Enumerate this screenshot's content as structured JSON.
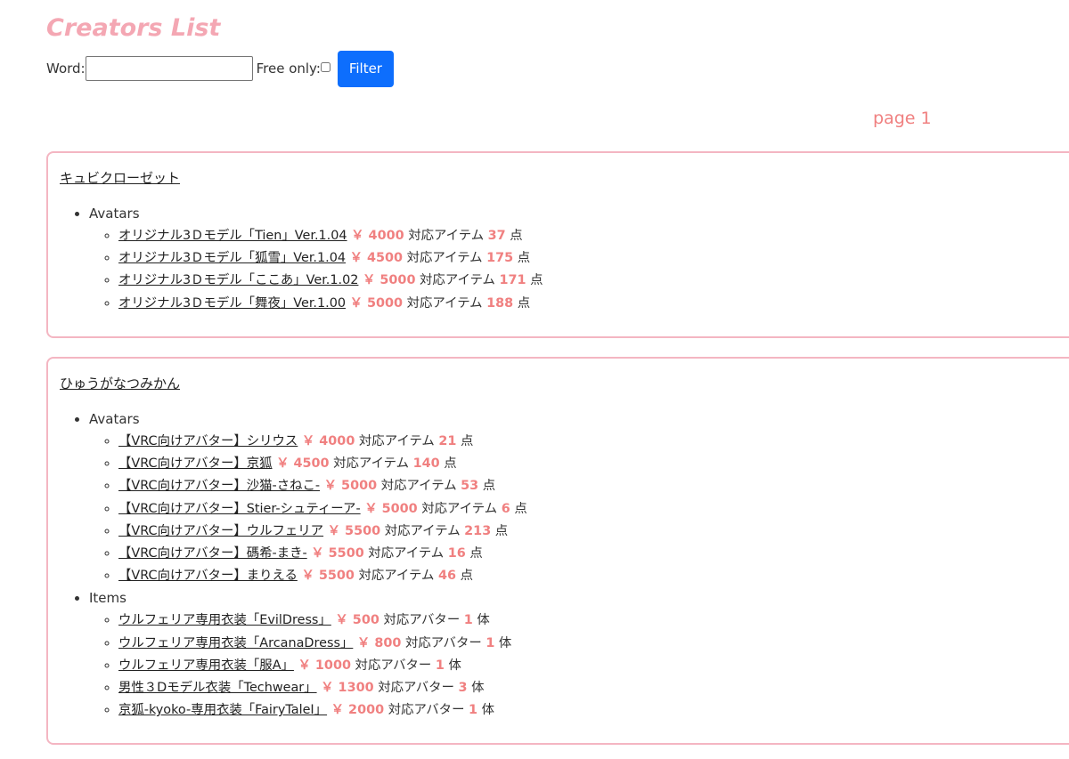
{
  "page": {
    "title": "Creators List",
    "word_label": "Word:",
    "word_value": "",
    "free_label": "Free only:",
    "free_checked": false,
    "filter_button": "Filter",
    "page_label": "page 1"
  },
  "creators": [
    {
      "name": "キュビクローゼット",
      "categories": [
        {
          "label": "Avatars",
          "items": [
            {
              "name": "オリジナル3Ｄモデル「Tien」Ver.1.04",
              "price": "￥ 4000",
              "count_label": "対応アイテム",
              "count": "37",
              "unit": "点"
            },
            {
              "name": "オリジナル3Ｄモデル「狐雪」Ver.1.04",
              "price": "￥ 4500",
              "count_label": "対応アイテム",
              "count": "175",
              "unit": "点"
            },
            {
              "name": "オリジナル3Ｄモデル「ここあ」Ver.1.02",
              "price": "￥ 5000",
              "count_label": "対応アイテム",
              "count": "171",
              "unit": "点"
            },
            {
              "name": "オリジナル3Ｄモデル「舞夜」Ver.1.00",
              "price": "￥ 5000",
              "count_label": "対応アイテム",
              "count": "188",
              "unit": "点"
            }
          ]
        }
      ]
    },
    {
      "name": "ひゅうがなつみかん",
      "categories": [
        {
          "label": "Avatars",
          "items": [
            {
              "name": "【VRC向けアバター】シリウス",
              "price": "￥ 4000",
              "count_label": "対応アイテム",
              "count": "21",
              "unit": "点"
            },
            {
              "name": "【VRC向けアバター】京狐",
              "price": "￥ 4500",
              "count_label": "対応アイテム",
              "count": "140",
              "unit": "点"
            },
            {
              "name": "【VRC向けアバター】沙猫-さねこ-",
              "price": "￥ 5000",
              "count_label": "対応アイテム",
              "count": "53",
              "unit": "点"
            },
            {
              "name": "【VRC向けアバター】Stier-シュティーア-",
              "price": "￥ 5000",
              "count_label": "対応アイテム",
              "count": "6",
              "unit": "点"
            },
            {
              "name": "【VRC向けアバター】ウルフェリア",
              "price": "￥ 5500",
              "count_label": "対応アイテム",
              "count": "213",
              "unit": "点"
            },
            {
              "name": "【VRC向けアバター】碼希-まき-",
              "price": "￥ 5500",
              "count_label": "対応アイテム",
              "count": "16",
              "unit": "点"
            },
            {
              "name": "【VRC向けアバター】まりえる",
              "price": "￥ 5500",
              "count_label": "対応アイテム",
              "count": "46",
              "unit": "点"
            }
          ]
        },
        {
          "label": "Items",
          "items": [
            {
              "name": "ウルフェリア専用衣装「EvilDress」",
              "price": "￥ 500",
              "count_label": "対応アバター",
              "count": "1",
              "unit": "体"
            },
            {
              "name": "ウルフェリア専用衣装「ArcanaDress」",
              "price": "￥ 800",
              "count_label": "対応アバター",
              "count": "1",
              "unit": "体"
            },
            {
              "name": "ウルフェリア専用衣装「服A」",
              "price": "￥ 1000",
              "count_label": "対応アバター",
              "count": "1",
              "unit": "体"
            },
            {
              "name": "男性３Dモデル衣装「Techwear」",
              "price": "￥ 1300",
              "count_label": "対応アバター",
              "count": "3",
              "unit": "体"
            },
            {
              "name": "京狐-kyoko-専用衣装「FairyTaleⅠ」",
              "price": "￥ 2000",
              "count_label": "対応アバター",
              "count": "1",
              "unit": "体"
            }
          ]
        }
      ]
    }
  ]
}
